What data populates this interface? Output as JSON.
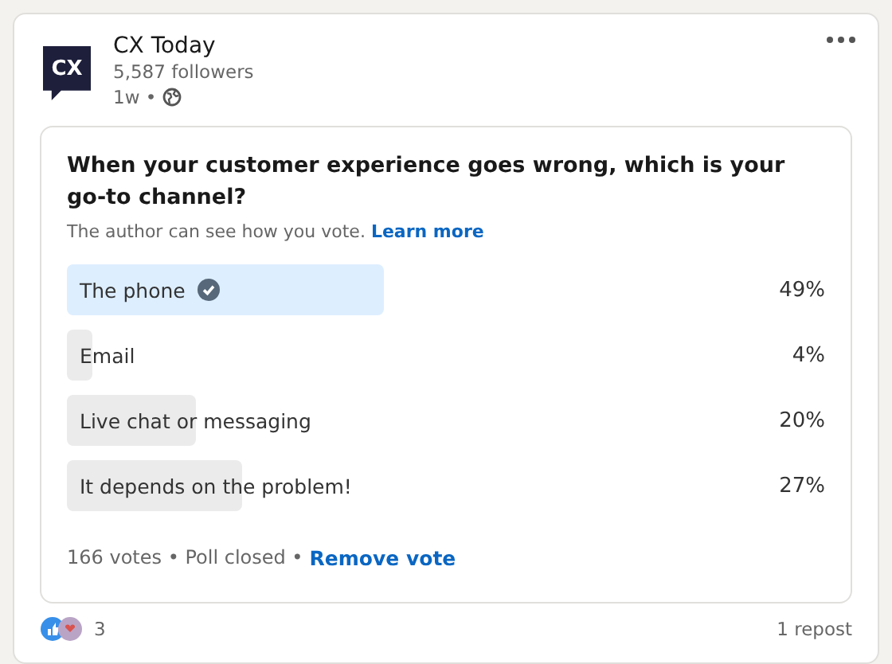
{
  "author": {
    "name": "CX Today",
    "logo": "CX",
    "followers": "5,587 followers",
    "age": "1w •"
  },
  "poll": {
    "question": "When your customer experience goes wrong, which is your go-to channel?",
    "note": "The author can see how you vote.",
    "note_link": "Learn more",
    "options": [
      {
        "label": "The phone",
        "selected": true,
        "level": 0.49,
        "percent": "49%"
      },
      {
        "label": "Email",
        "selected": false,
        "level": 0.04,
        "percent": "4%"
      },
      {
        "label": "Live chat or messaging",
        "selected": false,
        "level": 0.2,
        "percent": "20%"
      },
      {
        "label": "It depends on the problem!",
        "selected": false,
        "level": 0.27,
        "percent": "27%"
      }
    ],
    "summary": "166 votes • Poll closed •",
    "action": "Remove vote"
  },
  "reactions": {
    "count": "3",
    "reposts": "1 repost"
  }
}
